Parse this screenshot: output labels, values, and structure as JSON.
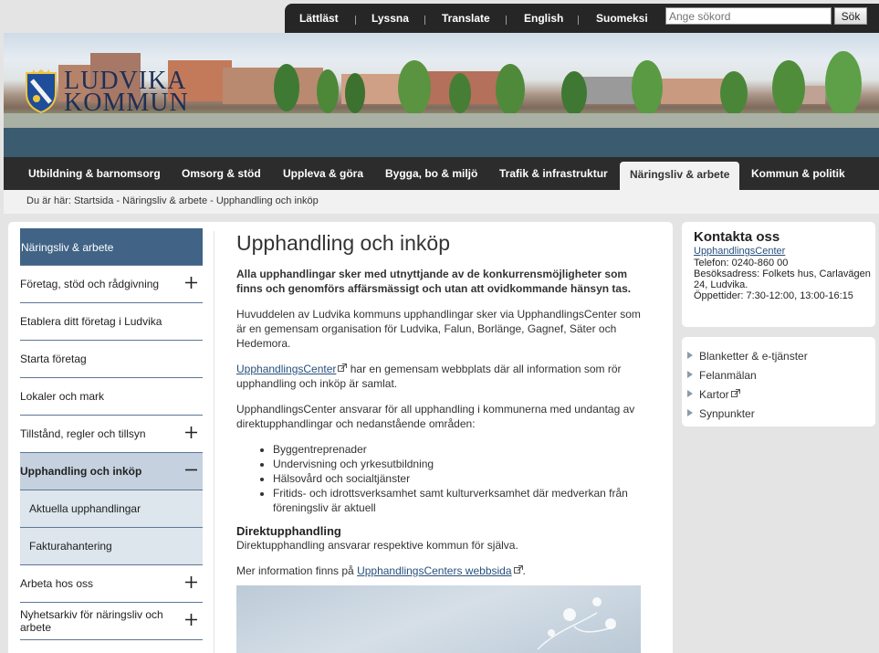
{
  "topbar": {
    "links": [
      "Lättläst",
      "Lyssna",
      "Translate",
      "English",
      "Suomeksi"
    ],
    "search_placeholder": "Ange sökord",
    "search_button": "Sök"
  },
  "logo": {
    "line1": "LUDVIKA",
    "line2": "KOMMUN"
  },
  "mainnav": {
    "items": [
      "Utbildning & barnomsorg",
      "Omsorg & stöd",
      "Uppleva & göra",
      "Bygga, bo & miljö",
      "Trafik & infrastruktur",
      "Näringsliv & arbete",
      "Kommun & politik"
    ],
    "active_index": 5
  },
  "breadcrumb": {
    "text": "Du är här:  Startsida - Näringsliv & arbete - Upphandling och inköp"
  },
  "sidenav": {
    "items": [
      {
        "label": "Näringsliv & arbete",
        "type": "head",
        "toggle": ""
      },
      {
        "label": "Företag, stöd och rådgivning",
        "type": "normal",
        "toggle": "plus"
      },
      {
        "label": "Etablera ditt företag i Ludvika",
        "type": "normal",
        "toggle": ""
      },
      {
        "label": "Starta företag",
        "type": "normal",
        "toggle": ""
      },
      {
        "label": "Lokaler och mark",
        "type": "normal",
        "toggle": ""
      },
      {
        "label": "Tillstånd, regler och tillsyn",
        "type": "normal",
        "toggle": "plus"
      },
      {
        "label": "Upphandling och inköp",
        "type": "current",
        "toggle": "minus"
      },
      {
        "label": "Aktuella upphandlingar",
        "type": "sub",
        "toggle": ""
      },
      {
        "label": "Fakturahantering",
        "type": "sub",
        "toggle": ""
      },
      {
        "label": "Arbeta hos oss",
        "type": "normal",
        "toggle": "plus"
      },
      {
        "label": "Nyhetsarkiv för näringsliv och arbete",
        "type": "two",
        "toggle": "plus"
      }
    ]
  },
  "article": {
    "title": "Upphandling och inköp",
    "lead": "Alla upphandlingar sker med utnyttjande av de konkurrensmöjligheter som finns och genomförs affärsmässigt och utan att ovidkommande hänsyn tas.",
    "p1": "Huvuddelen av Ludvika kommuns upphandlingar sker via UpphandlingsCenter som är en gemensam organisation för Ludvika, Falun, Borlänge, Gagnef, Säter och Hedemora.",
    "p2_link": "UpphandlingsCenter",
    "p2_rest": " har en gemensam webbplats där all information som rör upphandling och inköp är samlat.",
    "p3": "UpphandlingsCenter ansvarar för all upphandling i kommunerna med undantag av direktupphandlingar och nedanstående områden:",
    "list": [
      "Byggentreprenader",
      "Undervisning och yrkesutbildning",
      "Hälsovård och socialtjänster",
      "Fritids- och idrottsverksamhet samt kulturverksamhet där medverkan från föreningsliv är aktuell"
    ],
    "h2": "Direktupphandling",
    "p4": "Direktupphandling ansvarar respektive kommun för själva.",
    "p5_pre": "Mer information finns på ",
    "p5_link": "UpphandlingsCenters webbsida",
    "p5_post": "."
  },
  "contact": {
    "title": "Kontakta oss",
    "link": "UpphandlingsCenter",
    "phone": "Telefon: 0240-860 00",
    "address": "Besöksadress: Folkets hus, Carlavägen 24, Ludvika.",
    "hours": "Öppettider: 7:30-12:00, 13:00-16:15"
  },
  "quicklinks": [
    "Blanketter & e-tjänster",
    "Felanmälan",
    "Kartor",
    "Synpunkter"
  ],
  "colors": {
    "nav_dark": "#2c2c2c",
    "sidenav_head": "#406386",
    "link": "#27507c"
  }
}
